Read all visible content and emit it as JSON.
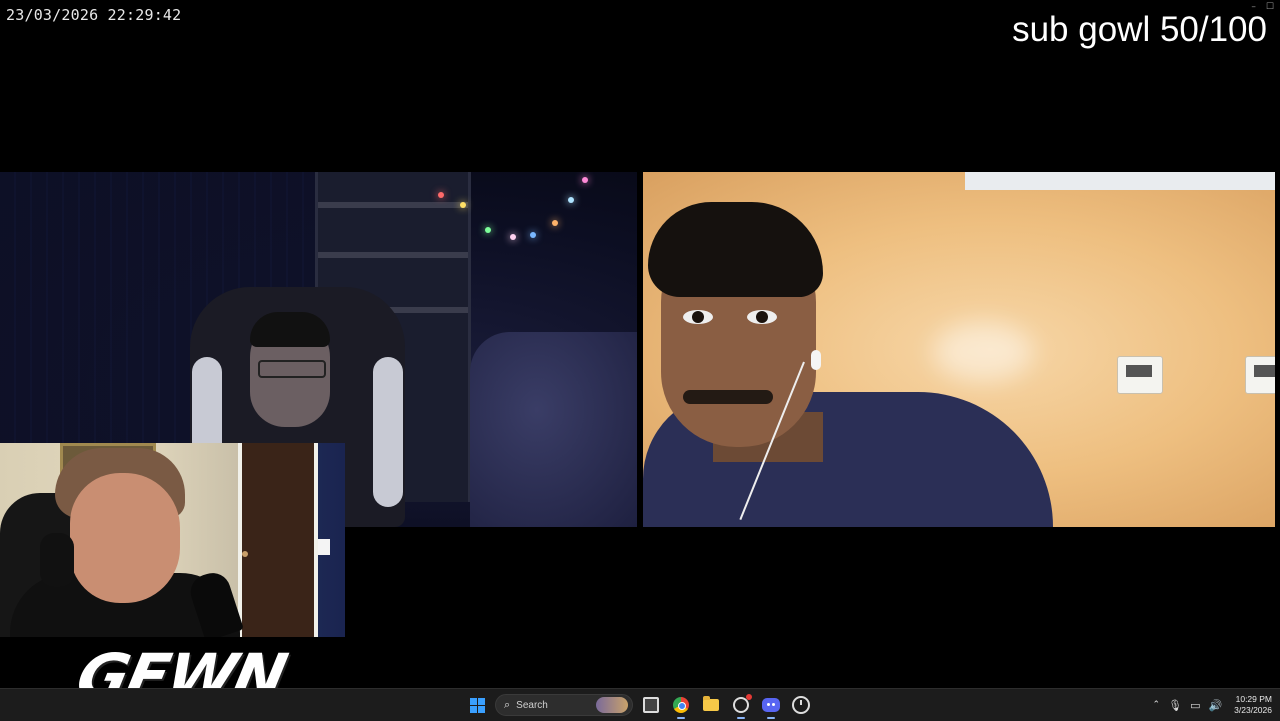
{
  "overlay": {
    "timestamp": "23/03/2026 22:29:42",
    "sub_goal": "sub gowl 50/100",
    "logo_text": "GEWN"
  },
  "window_controls": [
    "–",
    "☐",
    "✕"
  ],
  "taskbar": {
    "search_label": "Search",
    "apps": [
      "start-icon",
      "search-box",
      "task-view-icon",
      "chrome-icon",
      "file-explorer-icon",
      "obs-icon",
      "discord-icon",
      "clock-app-icon"
    ],
    "tray": {
      "time": "10:29 PM",
      "date": "3/23/2026"
    },
    "colors": {
      "background": "#1c1c1c",
      "start_accent": "#3aa0ff",
      "discord": "#5865f2"
    }
  }
}
